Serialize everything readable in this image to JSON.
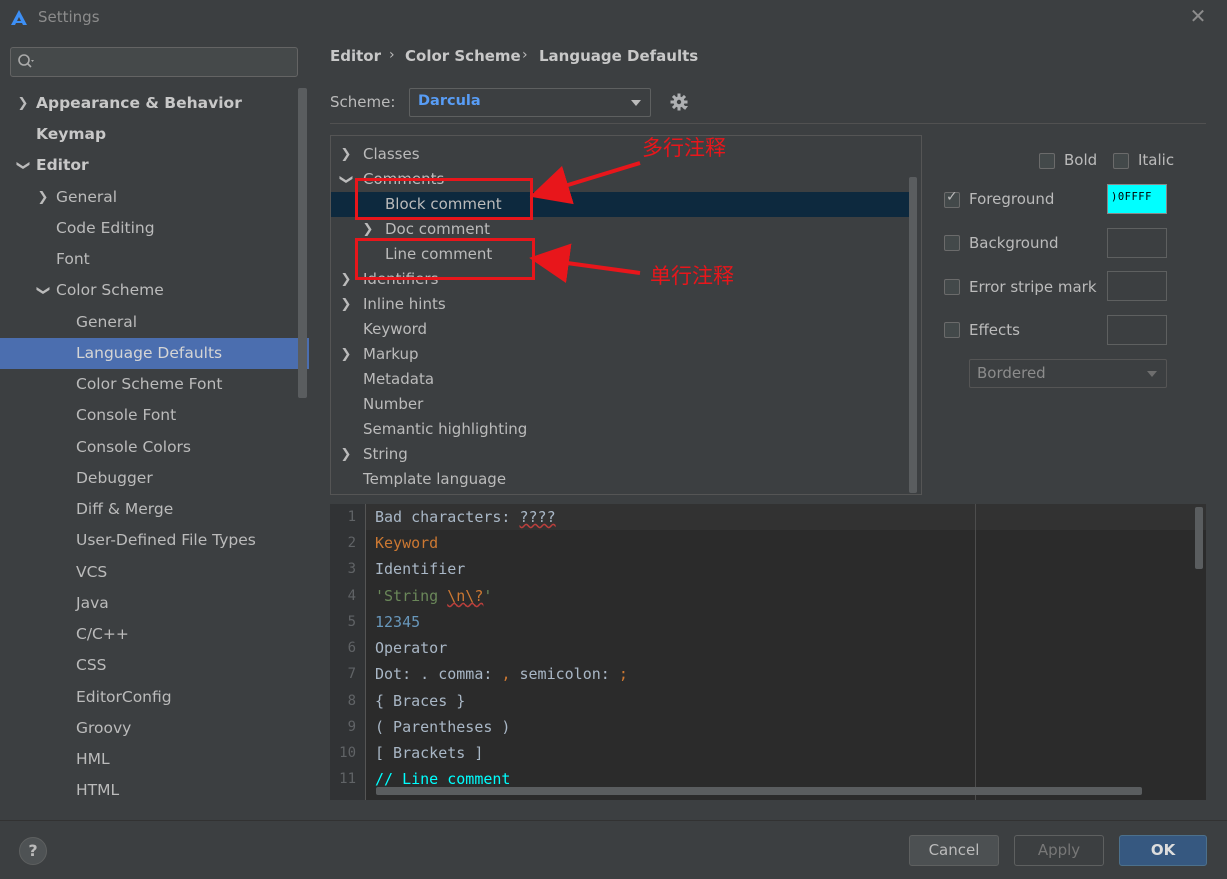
{
  "window": {
    "title": "Settings",
    "close": "✕"
  },
  "sidebar": {
    "search_placeholder": "",
    "items": [
      {
        "label": "Appearance & Behavior"
      },
      {
        "label": "Keymap"
      },
      {
        "label": "Editor"
      },
      {
        "label": "General"
      },
      {
        "label": "Code Editing"
      },
      {
        "label": "Font"
      },
      {
        "label": "Color Scheme"
      },
      {
        "label": "General"
      },
      {
        "label": "Language Defaults"
      },
      {
        "label": "Color Scheme Font"
      },
      {
        "label": "Console Font"
      },
      {
        "label": "Console Colors"
      },
      {
        "label": "Debugger"
      },
      {
        "label": "Diff & Merge"
      },
      {
        "label": "User-Defined File Types"
      },
      {
        "label": "VCS"
      },
      {
        "label": "Java"
      },
      {
        "label": "C/C++"
      },
      {
        "label": "CSS"
      },
      {
        "label": "EditorConfig"
      },
      {
        "label": "Groovy"
      },
      {
        "label": "HML"
      },
      {
        "label": "HTML"
      }
    ]
  },
  "breadcrumb": {
    "part1": "Editor",
    "part2": "Color Scheme",
    "part3": "Language Defaults",
    "sep": "›"
  },
  "scheme": {
    "label": "Scheme:",
    "value": "Darcula"
  },
  "attributes": {
    "items": [
      {
        "label": "Classes"
      },
      {
        "label": "Comments"
      },
      {
        "label": "Block comment"
      },
      {
        "label": "Doc comment"
      },
      {
        "label": "Line comment"
      },
      {
        "label": "Identifiers"
      },
      {
        "label": "Inline hints"
      },
      {
        "label": "Keyword"
      },
      {
        "label": "Markup"
      },
      {
        "label": "Metadata"
      },
      {
        "label": "Number"
      },
      {
        "label": "Semantic highlighting"
      },
      {
        "label": "String"
      },
      {
        "label": "Template language"
      }
    ]
  },
  "options": {
    "bold": "Bold",
    "italic": "Italic",
    "foreground": "Foreground",
    "foreground_value": ")0FFFF",
    "background": "Background",
    "error_stripe": "Error stripe mark",
    "effects": "Effects",
    "effects_type": "Bordered",
    "foreground_color": "#00FFFF"
  },
  "preview": {
    "lines": [
      {
        "n": "1",
        "parts": [
          "Bad characters: ",
          "????"
        ]
      },
      {
        "n": "2",
        "parts": [
          "Keyword"
        ]
      },
      {
        "n": "3",
        "parts": [
          "Identifier"
        ]
      },
      {
        "n": "4",
        "parts": [
          "'String ",
          "\\n\\?",
          "'"
        ]
      },
      {
        "n": "5",
        "parts": [
          "12345"
        ]
      },
      {
        "n": "6",
        "parts": [
          "Operator"
        ]
      },
      {
        "n": "7",
        "parts": [
          "Dot: ",
          ".",
          " comma: ",
          ",",
          " semicolon: ",
          ";"
        ]
      },
      {
        "n": "8",
        "parts": [
          "{ Braces }"
        ]
      },
      {
        "n": "9",
        "parts": [
          "( Parentheses )"
        ]
      },
      {
        "n": "10",
        "parts": [
          "[ Brackets ]"
        ]
      },
      {
        "n": "11",
        "parts": [
          "// Line comment"
        ]
      }
    ]
  },
  "annotations": {
    "block": "多行注释",
    "line": "单行注释"
  },
  "buttons": {
    "help": "?",
    "cancel": "Cancel",
    "apply": "Apply",
    "ok": "OK"
  }
}
